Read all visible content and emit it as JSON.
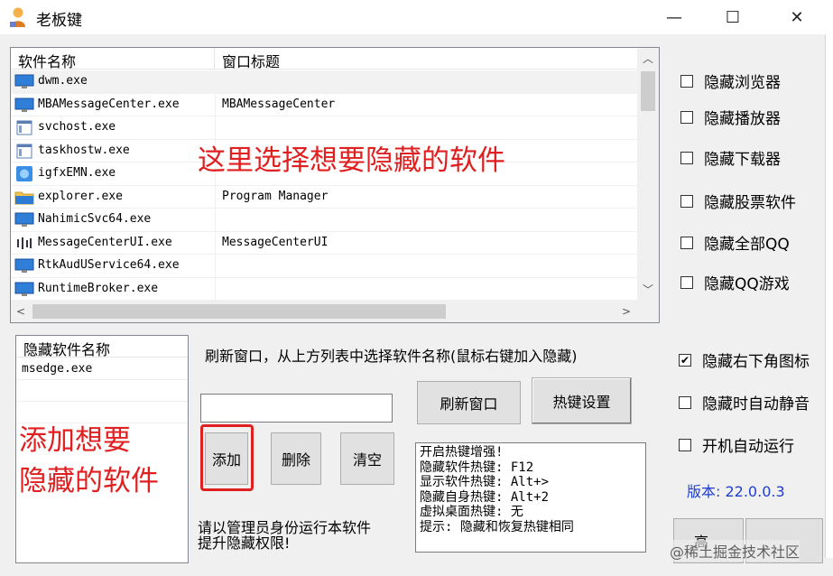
{
  "window": {
    "title": "老板键",
    "min_label": "—",
    "max_label": "☐",
    "close_label": "✕"
  },
  "process_list": {
    "columns": [
      "软件名称",
      "窗口标题"
    ],
    "rows": [
      {
        "name": "dwm.exe",
        "title": "",
        "icon": "monitor-icon"
      },
      {
        "name": "MBAMessageCenter.exe",
        "title": "MBAMessageCenter",
        "icon": "monitor-icon"
      },
      {
        "name": "svchost.exe",
        "title": "",
        "icon": "window-icon"
      },
      {
        "name": "taskhostw.exe",
        "title": "",
        "icon": "window-icon"
      },
      {
        "name": "igfxEMN.exe",
        "title": "",
        "icon": "graphics-icon"
      },
      {
        "name": "explorer.exe",
        "title": "Program Manager",
        "icon": "folder-icon"
      },
      {
        "name": "NahimicSvc64.exe",
        "title": "",
        "icon": "monitor-icon"
      },
      {
        "name": "MessageCenterUI.exe",
        "title": "MessageCenterUI",
        "icon": "audio-icon"
      },
      {
        "name": "RtkAudUService64.exe",
        "title": "",
        "icon": "monitor-icon"
      },
      {
        "name": "RuntimeBroker.exe",
        "title": "",
        "icon": "monitor-icon"
      }
    ]
  },
  "annotations": {
    "select_hint": "这里选择想要隐藏的软件",
    "add_hint_line1": "添加想要",
    "add_hint_line2": "隐藏的软件"
  },
  "options_top": [
    {
      "label": "隐藏浏览器",
      "checked": false
    },
    {
      "label": "隐藏播放器",
      "checked": false
    },
    {
      "label": "隐藏下载器",
      "checked": false
    },
    {
      "label": "隐藏股票软件",
      "checked": false
    },
    {
      "label": "隐藏全部QQ",
      "checked": false
    },
    {
      "label": "隐藏QQ游戏",
      "checked": false
    }
  ],
  "options_bottom": [
    {
      "label": "隐藏右下角图标",
      "checked": true
    },
    {
      "label": "隐藏时自动静音",
      "checked": false
    },
    {
      "label": "开机自动运行",
      "checked": false
    }
  ],
  "hidden_list": {
    "header": "隐藏软件名称",
    "items": [
      "msedge.exe"
    ]
  },
  "instructions": "刷新窗口，从上方列表中选择软件名称(鼠标右键加入隐藏)",
  "input": {
    "value": ""
  },
  "buttons": {
    "refresh": "刷新窗口",
    "hotkey_settings": "热键设置",
    "add": "添加",
    "delete": "删除",
    "clear": "清空",
    "bottom_right": "高"
  },
  "hotkey_info": [
    "开启热键增强!",
    "隐藏软件热键: F12",
    "显示软件热键: Alt+>",
    "隐藏自身热键: Alt+2",
    "虚拟桌面热键: 无",
    "提示: 隐藏和恢复热键相同"
  ],
  "admin_note": {
    "line1": "请以管理员身份运行本软件",
    "line2": "提升隐藏权限!"
  },
  "version": "版本: 22.0.0.3",
  "watermark": "@稀土掘金技术社区",
  "colors": {
    "annotation": "#e02020",
    "version": "#1f3fd0",
    "highlight_border": "#e02020"
  }
}
